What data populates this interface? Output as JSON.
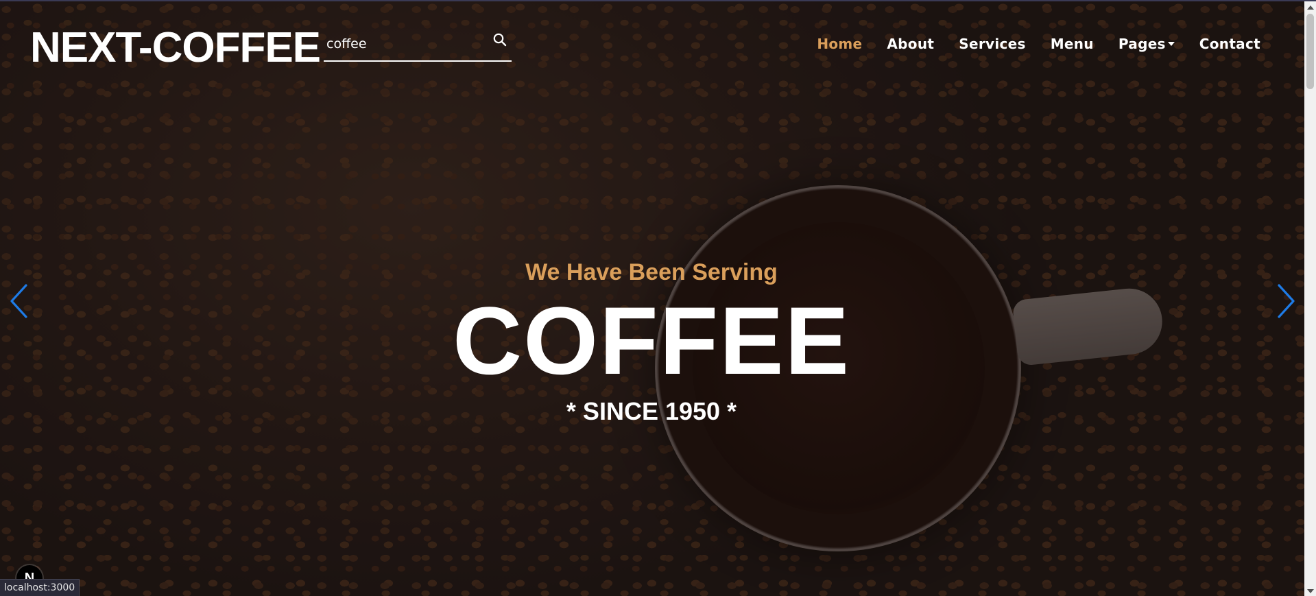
{
  "brand": {
    "name": "NEXT-COFFEE"
  },
  "search": {
    "value": "coffee",
    "icon": "search-icon"
  },
  "nav": {
    "items": [
      {
        "label": "Home",
        "active": true
      },
      {
        "label": "About",
        "active": false
      },
      {
        "label": "Services",
        "active": false
      },
      {
        "label": "Menu",
        "active": false
      },
      {
        "label": "Pages",
        "active": false,
        "dropdown": true
      },
      {
        "label": "Contact",
        "active": false
      }
    ]
  },
  "hero": {
    "subtitle": "We Have Been Serving",
    "title": "COFFEE",
    "since": "* SINCE 1950 *"
  },
  "carousel": {
    "prev_icon": "chevron-left-icon",
    "next_icon": "chevron-right-icon"
  },
  "dev_badge": {
    "letter": "N"
  },
  "status_bar": {
    "url": "localhost:3000"
  },
  "colors": {
    "accent": "#da9f5b",
    "arrow": "#1e7be6",
    "text": "#ffffff"
  }
}
